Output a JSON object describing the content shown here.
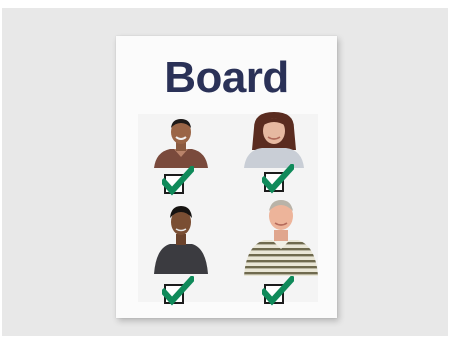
{
  "board": {
    "title": "Board",
    "title_color": "#2a3157",
    "check_color": "#0f8a5a"
  },
  "members": [
    {
      "name": "person-1",
      "checked": true
    },
    {
      "name": "person-2",
      "checked": true
    },
    {
      "name": "person-3",
      "checked": true
    },
    {
      "name": "person-4",
      "checked": true
    }
  ]
}
